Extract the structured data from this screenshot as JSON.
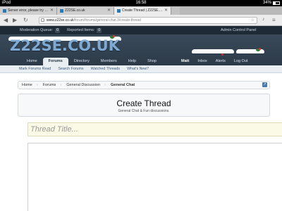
{
  "status_bar": {
    "carrier": "iPod",
    "time": "16:58",
    "battery": "34%"
  },
  "tabs": [
    {
      "title": "Server error, please try again",
      "close": "✕"
    },
    {
      "title": "Z22SE.co.uk",
      "close": "✕"
    },
    {
      "title": "Create Thread | Z22SE.co.uk",
      "close": "✕"
    }
  ],
  "address_bar": {
    "host": "www.z22se.co.uk",
    "path": "/forum/forums/general-chat.3/create-thread"
  },
  "site_topbar": {
    "moderation_queue_label": "Moderation Queue:",
    "moderation_queue_count": "0",
    "reported_items_label": "Reported Items:",
    "reported_items_count": "0",
    "admin_link": "Admin Control Panel"
  },
  "logo": "Z22SE.CO.UK",
  "nav": {
    "tabs": [
      "Home",
      "Forums",
      "Directory",
      "Members",
      "Help",
      "Shop"
    ],
    "active": "Forums",
    "right": [
      "Matt",
      "Inbox",
      "Alerts",
      "Log Out"
    ]
  },
  "subnav": [
    "Mark Forums Read",
    "Search Forums",
    "Watched Threads",
    "What's New?"
  ],
  "breadcrumb": [
    "Home",
    "Forums",
    "General Discussion",
    "General Chat"
  ],
  "page_title": "Create Thread",
  "page_subtitle": "General Chat & Fun discussions.",
  "thread_title_placeholder": "Thread Title...",
  "colors": {
    "topbar": "#1e2a36",
    "header": "#2c3a48",
    "logo": "#7ea9d3",
    "subnav": "#e9eef3",
    "title_input": "#fbfae7"
  }
}
